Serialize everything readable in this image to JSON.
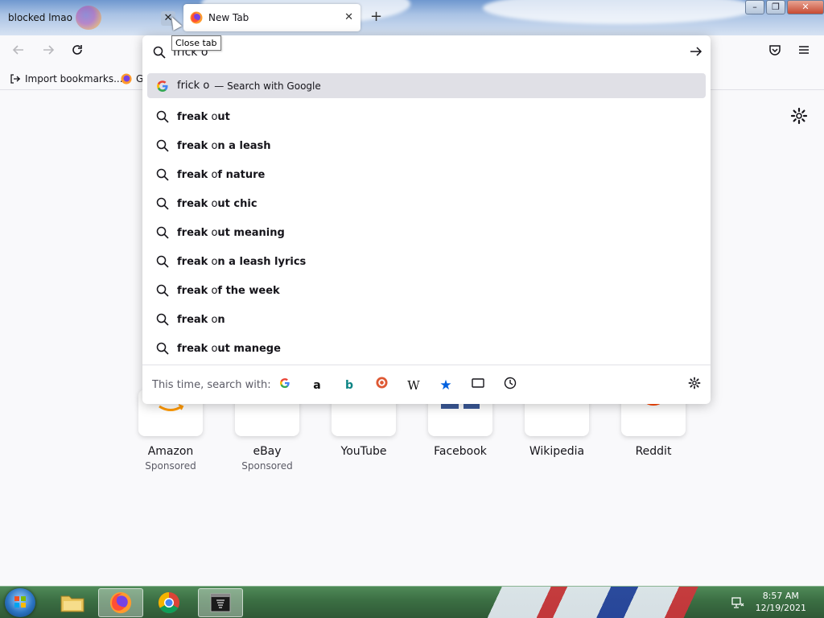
{
  "tabs": [
    {
      "title": "blocked lmao"
    },
    {
      "title": "New Tab"
    }
  ],
  "tooltip": "Close tab",
  "bookmarks": {
    "import_label": "Import bookmarks...",
    "getting_started_label": "G"
  },
  "urlbar": {
    "value": "frick o",
    "top_result": {
      "query": "frick o",
      "suffix": "— Search with Google"
    },
    "suggestions": [
      {
        "typed": "freak",
        "rest_plain": " o",
        "rest_bold": "ut"
      },
      {
        "typed": "freak",
        "rest_plain": " o",
        "rest_bold": "n a leash"
      },
      {
        "typed": "freak",
        "rest_plain": " o",
        "rest_bold": "f nature"
      },
      {
        "typed": "freak",
        "rest_plain": " o",
        "rest_bold": "ut chic"
      },
      {
        "typed": "freak",
        "rest_plain": " o",
        "rest_bold": "ut meaning"
      },
      {
        "typed": "freak",
        "rest_plain": " o",
        "rest_bold": "n a leash lyrics"
      },
      {
        "typed": "freak",
        "rest_plain": " o",
        "rest_bold": "f the week"
      },
      {
        "typed": "freak",
        "rest_plain": " o",
        "rest_bold": "n"
      },
      {
        "typed": "freak",
        "rest_plain": " o",
        "rest_bold": "ut manege"
      }
    ],
    "oneoff_label": "This time, search with:",
    "engines": [
      "Google",
      "Amazon",
      "Bing",
      "DuckDuckGo",
      "Wikipedia",
      "Bookmarks",
      "Tabs",
      "History"
    ]
  },
  "top_sites": [
    {
      "title": "Amazon",
      "sub": "Sponsored"
    },
    {
      "title": "eBay",
      "sub": "Sponsored"
    },
    {
      "title": "YouTube",
      "sub": ""
    },
    {
      "title": "Facebook",
      "sub": ""
    },
    {
      "title": "Wikipedia",
      "sub": ""
    },
    {
      "title": "Reddit",
      "sub": ""
    }
  ],
  "taskbar": {
    "time": "8:57 AM",
    "date": "12/19/2021"
  },
  "colors": {
    "selected_row": "#e0e0e6",
    "taskbar": "#3b6e43",
    "accent_blue": "#0060df"
  }
}
